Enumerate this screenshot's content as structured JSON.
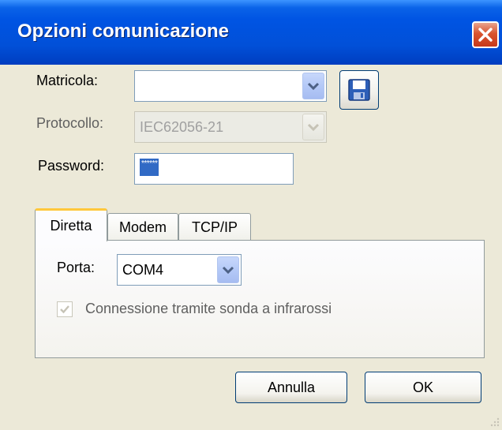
{
  "window": {
    "title": "Opzioni comunicazione"
  },
  "form": {
    "matricola": {
      "label": "Matricola:",
      "value": ""
    },
    "protocollo": {
      "label": "Protocollo:",
      "value": "IEC62056-21"
    },
    "password": {
      "label": "Password:",
      "masked_value": "******"
    }
  },
  "tabs": [
    {
      "label": "Diretta",
      "active": true
    },
    {
      "label": "Modem",
      "active": false
    },
    {
      "label": "TCP/IP",
      "active": false
    }
  ],
  "diretta": {
    "porta_label": "Porta:",
    "porta_value": "COM4",
    "infrared_label": "Connessione tramite sonda a infrarossi",
    "infrared_checked": true
  },
  "buttons": {
    "cancel": "Annulla",
    "ok": "OK"
  },
  "icons": {
    "close": "close-icon",
    "save": "floppy-disk-icon",
    "dropdown": "chevron-down-icon",
    "check": "checkmark-icon"
  },
  "colors": {
    "titlebar": "#0054e3",
    "window_bg": "#ece9d8",
    "selection": "#316ac5",
    "active_tab_accent": "#ffc83c",
    "close_button": "#d9542f"
  }
}
